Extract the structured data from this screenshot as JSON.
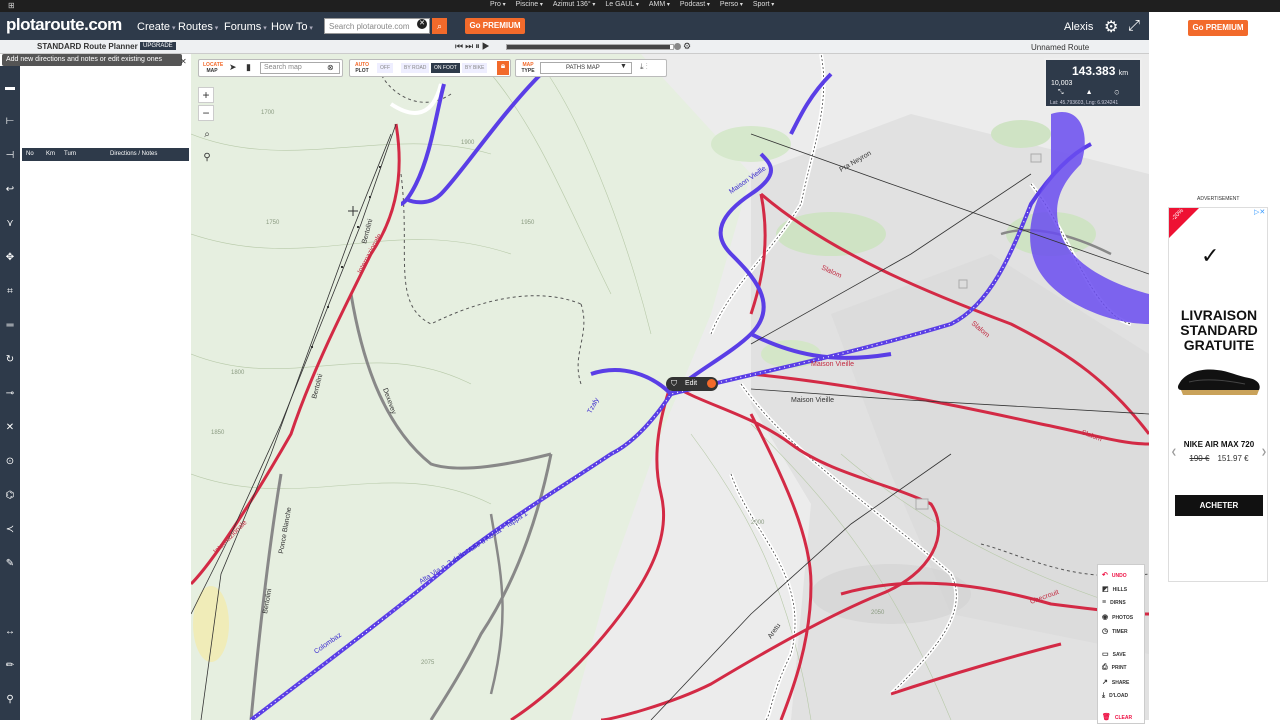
{
  "system_menu": [
    "Pro",
    "Piscine",
    "Azimut 136°",
    "Le GAUL",
    "AMM",
    "Podcast",
    "Perso",
    "Sport"
  ],
  "nav": {
    "logo": "plotaroute.com",
    "links": [
      "Create",
      "Routes",
      "Forums",
      "How To"
    ],
    "search_placeholder": "Search plotaroute.com",
    "premium": "Go PREMIUM",
    "user": "Alexis"
  },
  "routebar": {
    "planner": "STANDARD Route Planner",
    "upgrade": "UPGRADE",
    "route_name": "Unnamed Route",
    "progress": 0.98
  },
  "tooltip": "Add new directions and notes or edit existing ones",
  "directions_table": {
    "headers": [
      "No",
      "Km",
      "Turn",
      "Directions / Notes"
    ]
  },
  "map_controls": {
    "locate": [
      "LOCATE",
      "MAP"
    ],
    "search_placeholder": "Search map",
    "auto": [
      "AUTO",
      "PLOT"
    ],
    "plot_modes": [
      "OFF",
      "BY ROAD",
      "ON FOOT",
      "BY BIKE"
    ],
    "maptype": [
      "MAP",
      "TYPE"
    ],
    "maptype_value": "PATHS MAP"
  },
  "stats": {
    "distance": "143.383",
    "unit": "km",
    "climb": "10,003",
    "latlng": "Lat: 45.793603, Lng: 6.924241"
  },
  "edit_label": "Edit",
  "right_menu": [
    "UNDO",
    "HILLS",
    "DIRNS",
    "PHOTOS",
    "TIMER",
    "SAVE",
    "PRINT",
    "SHARE",
    "D'LOAD",
    "CLEAR"
  ],
  "map_labels": {
    "roads": [
      "Bertolini",
      "Internazionale",
      "Tzaly",
      "Dexevey",
      "Colombaz",
      "Alta Via n. 2 della Valle d'Aosta - Tappa 1",
      "Slalom",
      "Maison Vieille",
      "Pra Neyron",
      "Checrouit",
      "Aretu",
      "Ponce Blanche",
      "Col de Tzaly"
    ],
    "places": [
      "Maison Vieille"
    ],
    "contours": [
      "1700",
      "1750",
      "1800",
      "1850",
      "1900",
      "1950",
      "2000",
      "2050",
      "2075"
    ]
  },
  "ad": {
    "label": "ADVERTISEMENT",
    "badge": "-20%",
    "title": "LIVRAISON STANDARD GRATUITE",
    "product": "NIKE AIR MAX 720",
    "old_price": "190 €",
    "new_price": "151.97 €",
    "button": "ACHETER"
  },
  "colors": {
    "accent": "#f26a2b",
    "nav": "#2e3a4a",
    "route": "#5a3ee6",
    "trail": "#d32a45"
  }
}
